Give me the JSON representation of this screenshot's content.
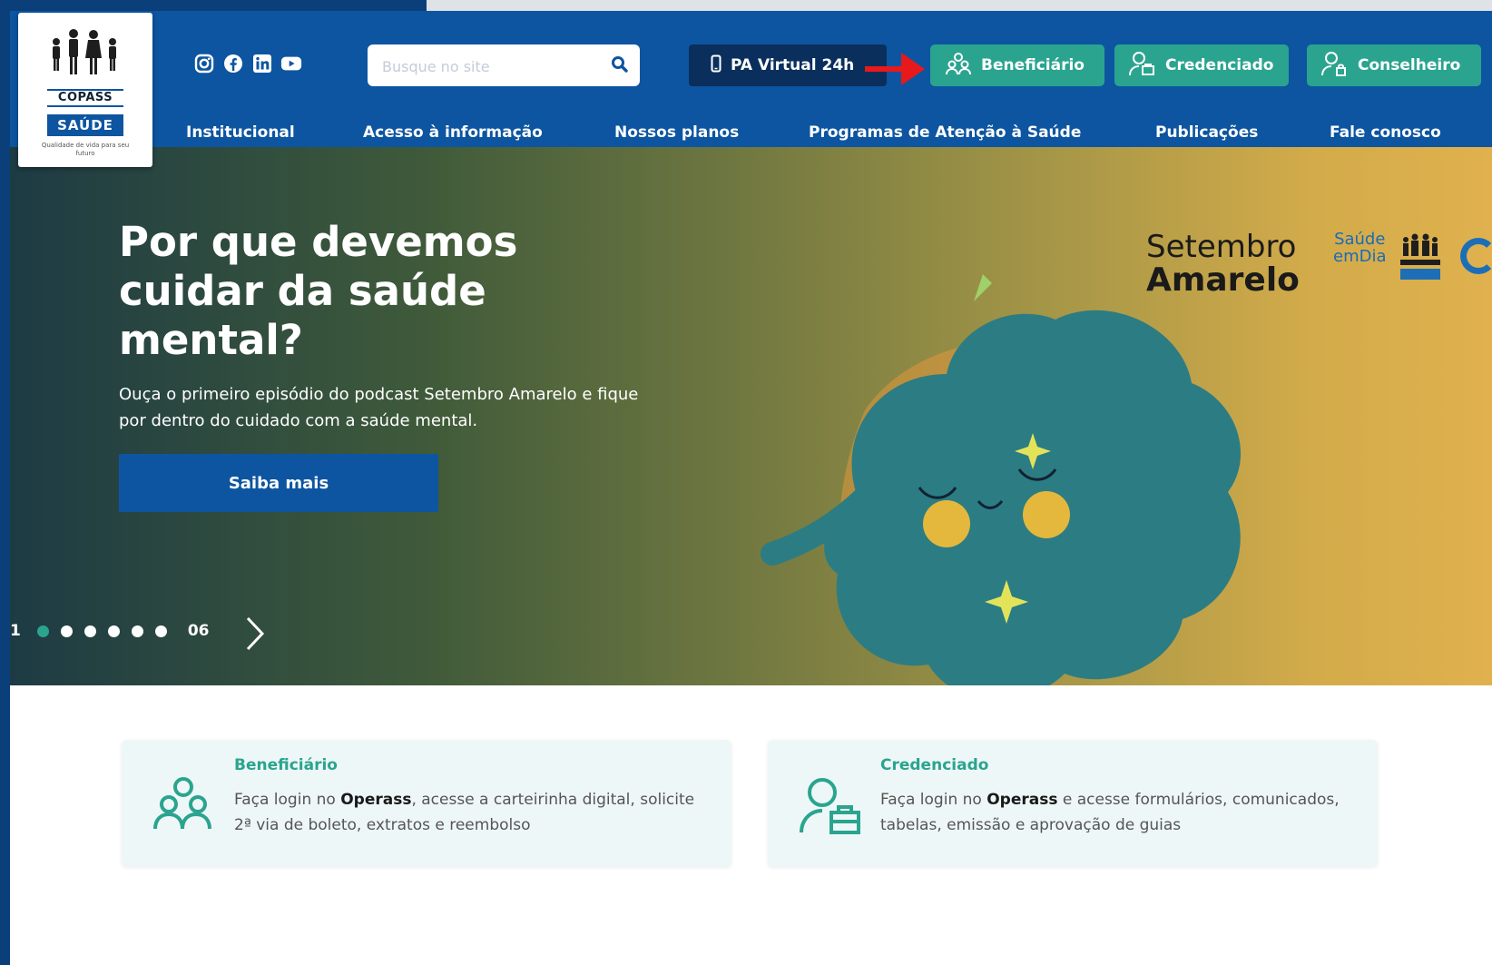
{
  "header": {
    "logo": {
      "name": "COPASS",
      "band": "SAÚDE",
      "tagline": "Qualidade de vida para seu futuro"
    },
    "social_icons": [
      "instagram-icon",
      "facebook-icon",
      "linkedin-icon",
      "youtube-icon"
    ],
    "search": {
      "placeholder": "Busque no site",
      "value": ""
    },
    "pa_virtual_label": "PA Virtual 24h",
    "role_buttons": [
      {
        "label": "Beneficiário",
        "icon": "group-icon"
      },
      {
        "label": "Credenciado",
        "icon": "user-briefcase-icon"
      },
      {
        "label": "Conselheiro",
        "icon": "user-lock-icon"
      }
    ],
    "nav": [
      "Institucional",
      "Acesso à informação",
      "Nossos planos",
      "Programas de Atenção à Saúde",
      "Publicações",
      "Fale conosco"
    ]
  },
  "hero": {
    "title": "Por que devemos cuidar da saúde mental?",
    "subtitle": "Ouça o primeiro episódio do podcast Setembro Amarelo e fique por dentro do cuidado com a saúde mental.",
    "button_label": "Saiba mais",
    "pager": {
      "current": "1",
      "total": "06",
      "dots": 6,
      "active_dot": 0
    },
    "campaign": {
      "word1": "Setembro",
      "word2": "Amarelo",
      "partner_line1": "Saúde",
      "partner_line2": "emDia"
    }
  },
  "cards": [
    {
      "title": "Beneficiário",
      "text_pre": "Faça login no ",
      "text_bold": "Operass",
      "text_post": ", acesse a carteirinha digital, solicite 2ª via de boleto, extratos e reembolso"
    },
    {
      "title": "Credenciado",
      "text_pre": "Faça login no ",
      "text_bold": "Operass",
      "text_post": " e acesse formulários, comunicados, tabelas, emissão e aprovação de guias"
    }
  ],
  "colors": {
    "primary": "#0d55a0",
    "dark": "#0a2f5c",
    "accent": "#2aa48f",
    "arrow": "#e8191b"
  }
}
